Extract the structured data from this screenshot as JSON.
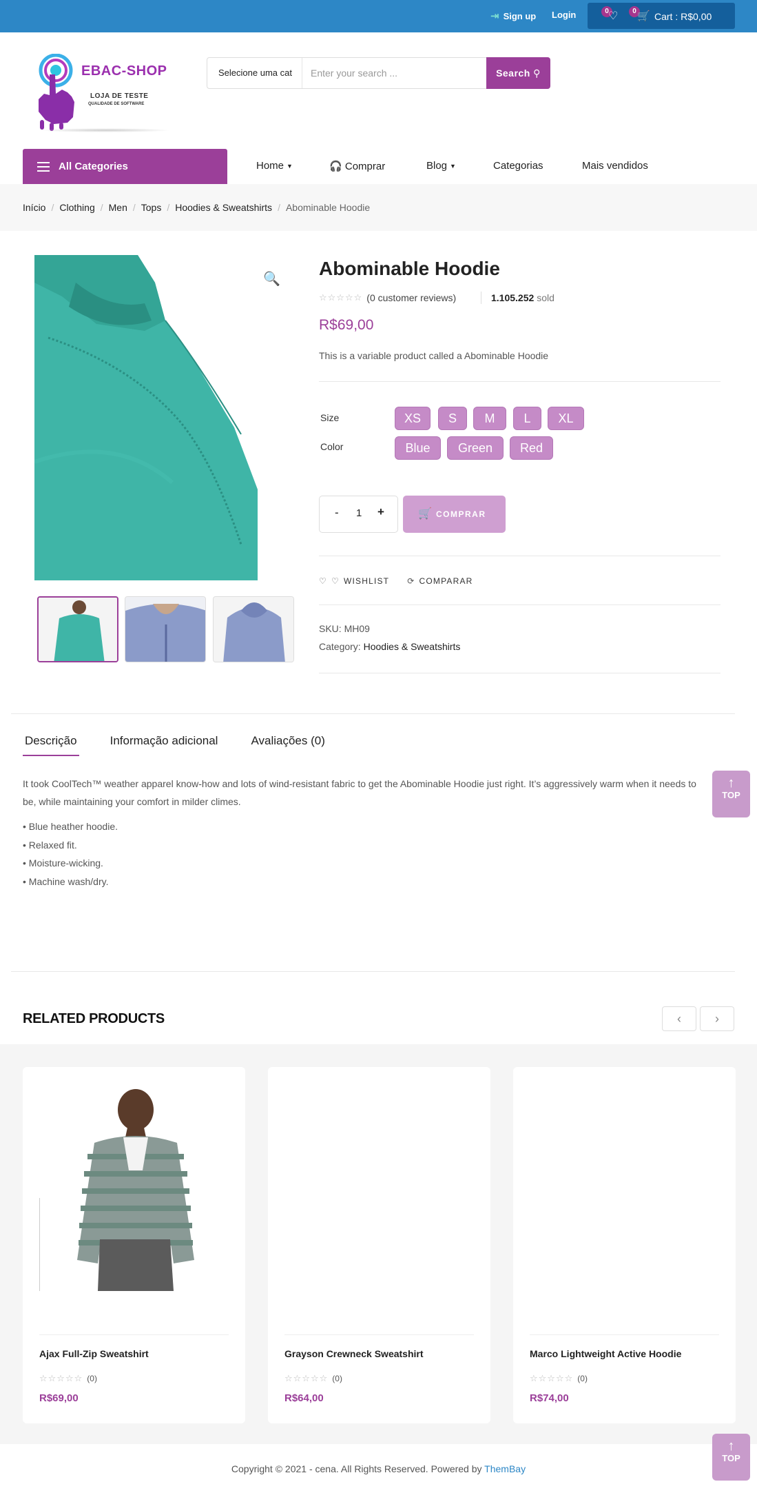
{
  "topbar": {
    "signup": "Sign up",
    "login": "Login",
    "wishlist_count": "0",
    "cart_count": "0",
    "cart_label": "Cart : R$0,00"
  },
  "logo": {
    "brand": "EBAC-SHOP",
    "line1": "LOJA DE TESTE",
    "line2": "QUALIDADE DE SOFTWARE"
  },
  "search": {
    "category": "Selecione uma cat",
    "placeholder": "Enter your search ...",
    "button": "Search"
  },
  "nav": {
    "all_categories": "All Categories",
    "items": [
      "Home",
      "Comprar",
      "Blog",
      "Categorias",
      "Mais vendidos"
    ]
  },
  "breadcrumb": [
    "Início",
    "Clothing",
    "Men",
    "Tops",
    "Hoodies & Sweatshirts",
    "Abominable Hoodie"
  ],
  "product": {
    "title": "Abominable Hoodie",
    "reviews": "(0 customer reviews)",
    "sold_count": "1.105.252",
    "sold_label": "sold",
    "price": "R$69,00",
    "short_description": "This is a variable product called a Abominable Hoodie",
    "size_label": "Size",
    "sizes": [
      "XS",
      "S",
      "M",
      "L",
      "XL"
    ],
    "color_label": "Color",
    "colors": [
      "Blue",
      "Green",
      "Red"
    ],
    "quantity": "1",
    "qty_minus": "-",
    "qty_plus": "+",
    "buy_button": "COMPRAR",
    "wishlist": "WISHLIST",
    "compare": "COMPARAR",
    "sku_label": "SKU:",
    "sku": "MH09",
    "category_label": "Category:",
    "category": "Hoodies & Sweatshirts"
  },
  "tabs": [
    "Descrição",
    "Informação adicional",
    "Avaliações (0)"
  ],
  "description": {
    "text": "It took CoolTech™ weather apparel know-how and lots of wind-resistant fabric to get the Abominable Hoodie just right. It’s aggressively warm when it needs to be, while maintaining your comfort in milder climes.",
    "bullets": [
      "• Blue heather hoodie.",
      "• Relaxed fit.",
      "• Moisture-wicking.",
      "• Machine wash/dry."
    ]
  },
  "top_button": "TOP",
  "related": {
    "title": "RELATED PRODUCTS",
    "products": [
      {
        "name": "Ajax Full-Zip Sweatshirt",
        "reviews": "(0)",
        "price": "R$69,00"
      },
      {
        "name": "Grayson Crewneck Sweatshirt",
        "reviews": "(0)",
        "price": "R$64,00"
      },
      {
        "name": "Marco Lightweight Active Hoodie",
        "reviews": "(0)",
        "price": "R$74,00"
      }
    ]
  },
  "footer": {
    "copyright": "Copyright © 2021 - cena. All Rights Reserved. Powered by",
    "powered_by": "ThemBay"
  },
  "colors": {
    "topbar": "#2d87c6",
    "accent": "#9b3f99",
    "chip": "#c58bc7"
  }
}
